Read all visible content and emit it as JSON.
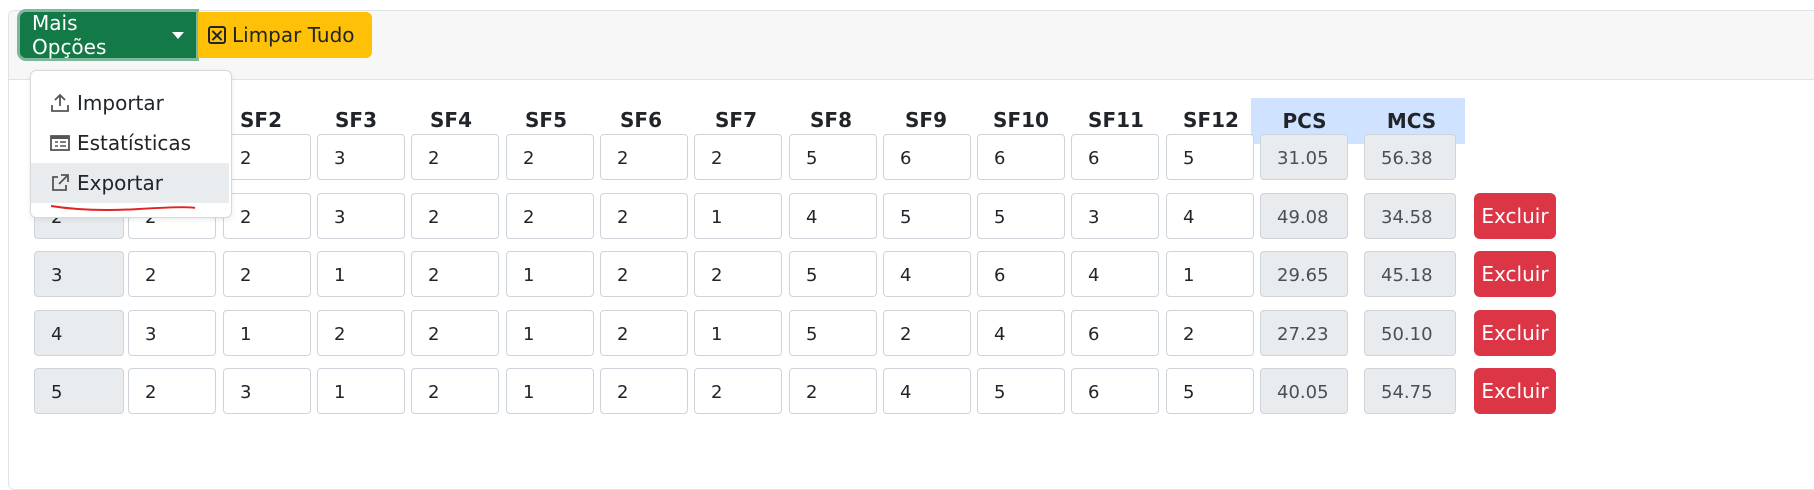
{
  "toolbar": {
    "more_options_label": "Mais Opções",
    "clear_all_label": "Limpar Tudo"
  },
  "dropdown": {
    "items": [
      {
        "label": "Importar",
        "icon": "upload-icon"
      },
      {
        "label": "Estatísticas",
        "icon": "table-icon"
      },
      {
        "label": "Exportar",
        "icon": "external-link-icon"
      }
    ]
  },
  "table": {
    "headers": [
      "SF2",
      "SF3",
      "SF4",
      "SF5",
      "SF6",
      "SF7",
      "SF8",
      "SF9",
      "SF10",
      "SF11",
      "SF12",
      "PCS",
      "MCS"
    ],
    "delete_label": "Excluir",
    "rows": [
      {
        "id": "",
        "sf1": "",
        "sf": [
          "2",
          "3",
          "2",
          "2",
          "2",
          "2",
          "5",
          "6",
          "6",
          "6",
          "5"
        ],
        "pcs": "31.05",
        "mcs": "56.38"
      },
      {
        "id": "2",
        "sf1": "2",
        "sf": [
          "2",
          "3",
          "2",
          "2",
          "2",
          "1",
          "4",
          "5",
          "5",
          "3",
          "4"
        ],
        "pcs": "49.08",
        "mcs": "34.58"
      },
      {
        "id": "3",
        "sf1": "2",
        "sf": [
          "2",
          "1",
          "2",
          "1",
          "2",
          "2",
          "5",
          "4",
          "6",
          "4",
          "1"
        ],
        "pcs": "29.65",
        "mcs": "45.18"
      },
      {
        "id": "4",
        "sf1": "3",
        "sf": [
          "1",
          "2",
          "2",
          "1",
          "2",
          "1",
          "5",
          "2",
          "4",
          "6",
          "2"
        ],
        "pcs": "27.23",
        "mcs": "50.10"
      },
      {
        "id": "5",
        "sf1": "2",
        "sf": [
          "3",
          "1",
          "2",
          "1",
          "2",
          "2",
          "2",
          "4",
          "5",
          "6",
          "5"
        ],
        "pcs": "40.05",
        "mcs": "54.75"
      }
    ]
  },
  "colors": {
    "green": "#137a47",
    "yellow": "#ffc107",
    "danger": "#dc3545",
    "header_highlight": "#cfe2ff"
  }
}
